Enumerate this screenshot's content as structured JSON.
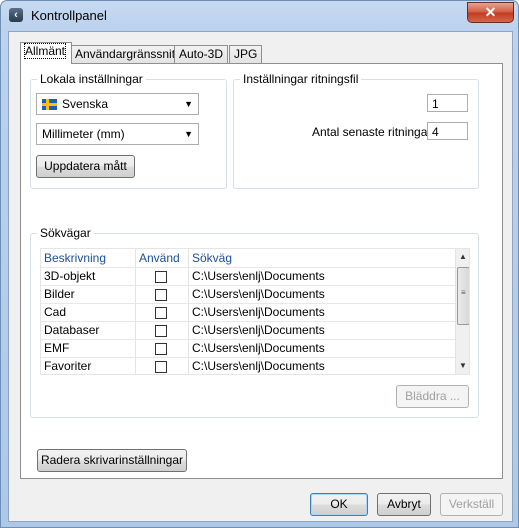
{
  "window": {
    "title": "Kontrollpanel",
    "close_symbol": "✕"
  },
  "tabs": [
    "Allmänt",
    "Användargränssnitt",
    "Auto-3D",
    "JPG"
  ],
  "locale_group": {
    "label": "Lokala inställningar",
    "language": "Svenska",
    "unit": "Millimeter (mm)",
    "update_button": "Uppdatera mått"
  },
  "drawing_group": {
    "label": "Inställningar ritningsfil",
    "value1": "1",
    "recent_label": "Antal senaste ritningar",
    "recent_value": "4"
  },
  "paths_group": {
    "label": "Sökvägar",
    "columns": [
      "Beskrivning",
      "Använd",
      "Sökväg"
    ],
    "rows": [
      {
        "description": "3D-objekt",
        "path": "C:\\Users\\enlj\\Documents"
      },
      {
        "description": "Bilder",
        "path": "C:\\Users\\enlj\\Documents"
      },
      {
        "description": "Cad",
        "path": "C:\\Users\\enlj\\Documents"
      },
      {
        "description": "Databaser",
        "path": "C:\\Users\\enlj\\Documents"
      },
      {
        "description": "EMF",
        "path": "C:\\Users\\enlj\\Documents"
      },
      {
        "description": "Favoriter",
        "path": "C:\\Users\\enlj\\Documents"
      }
    ],
    "browse_button": "Bläddra ..."
  },
  "printer_button": "Radera skrivarinställningar",
  "footer": {
    "ok": "OK",
    "cancel": "Avbryt",
    "apply": "Verkställ"
  }
}
